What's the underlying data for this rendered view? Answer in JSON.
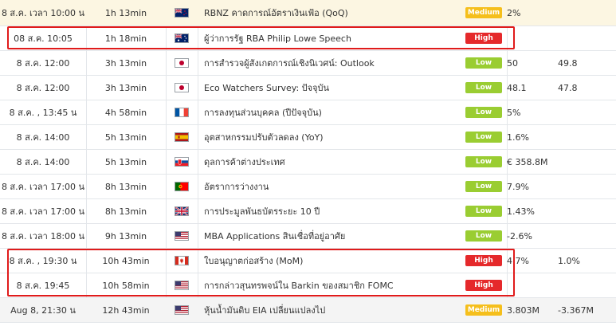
{
  "colors": {
    "high": "#e5292b",
    "medium": "#f5bf1c",
    "low": "#9acd32",
    "highlight": "#e01b1b"
  },
  "rows": [
    {
      "time": "8 ส.ค. เวลา 10:00 น",
      "left": "1h 13min",
      "flag": "new-zealand-flag",
      "event": "RBNZ คาดการณ์อัตราเงินเฟ้อ (QoQ)",
      "importance": "Medium",
      "actual": "2%",
      "previous": ""
    },
    {
      "time": "08 ส.ค. 10:05",
      "left": "1h 18min",
      "flag": "australia-flag",
      "event": "ผู้ว่าการรัฐ RBA Philip Lowe Speech",
      "importance": "High",
      "actual": "",
      "previous": ""
    },
    {
      "time": "8 ส.ค. 12:00",
      "left": "3h 13min",
      "flag": "japan-flag",
      "event": "การสำรวจผู้สังเกตการณ์เชิงนิเวศน์: Outlook",
      "importance": "Low",
      "actual": "50",
      "previous": "49.8"
    },
    {
      "time": "8 ส.ค. 12:00",
      "left": "3h 13min",
      "flag": "japan-flag",
      "event": "Eco Watchers Survey: ปัจจุบัน",
      "importance": "Low",
      "actual": "48.1",
      "previous": "47.8"
    },
    {
      "time": "8 ส.ค. , 13:45 น",
      "left": "4h 58min",
      "flag": "france-flag",
      "event": "การลงทุนส่วนบุคคล (ปีปัจจุบัน)",
      "importance": "Low",
      "actual": "5%",
      "previous": ""
    },
    {
      "time": "8 ส.ค. 14:00",
      "left": "5h 13min",
      "flag": "spain-flag",
      "event": "อุตสาหกรรมปรับตัวลดลง (YoY)",
      "importance": "Low",
      "actual": "1.6%",
      "previous": ""
    },
    {
      "time": "8 ส.ค. 14:00",
      "left": "5h 13min",
      "flag": "slovakia-flag",
      "event": "ดุลการค้าต่างประเทศ",
      "importance": "Low",
      "actual": "€ 358.8M",
      "previous": ""
    },
    {
      "time": "8 ส.ค. เวลา 17:00 น",
      "left": "8h 13min",
      "flag": "portugal-flag",
      "event": "อัตราการว่างงาน",
      "importance": "Low",
      "actual": "7.9%",
      "previous": ""
    },
    {
      "time": "8 ส.ค. เวลา 17:00 น",
      "left": "8h 13min",
      "flag": "united-kingdom-flag",
      "event": "การประมูลพันธบัตรระยะ 10 ปี",
      "importance": "Low",
      "actual": "1.43%",
      "previous": ""
    },
    {
      "time": "8 ส.ค. เวลา 18:00 น",
      "left": "9h 13min",
      "flag": "united-states-flag",
      "event": "MBA Applications สินเชื่อที่อยู่อาศัย",
      "importance": "Low",
      "actual": "-2.6%",
      "previous": ""
    },
    {
      "time": "8 ส.ค. , 19:30 น",
      "left": "10h 43min",
      "flag": "canada-flag",
      "event": "ใบอนุญาตก่อสร้าง (MoM)",
      "importance": "High",
      "actual": "4.7%",
      "previous": "1.0%"
    },
    {
      "time": "8 ส.ค. 19:45",
      "left": "10h 58min",
      "flag": "united-states-flag",
      "event": "การกล่าวสุนทรพจน์ใน Barkin ของสมาชิก FOMC",
      "importance": "High",
      "actual": "",
      "previous": ""
    },
    {
      "time": "Aug 8, 21:30 น",
      "left": "12h 43min",
      "flag": "united-states-flag",
      "event": "หุ้นน้ำมันดิบ EIA เปลี่ยนแปลงไป",
      "importance": "Medium",
      "actual": "3.803M",
      "previous": "-3.367M"
    }
  ]
}
